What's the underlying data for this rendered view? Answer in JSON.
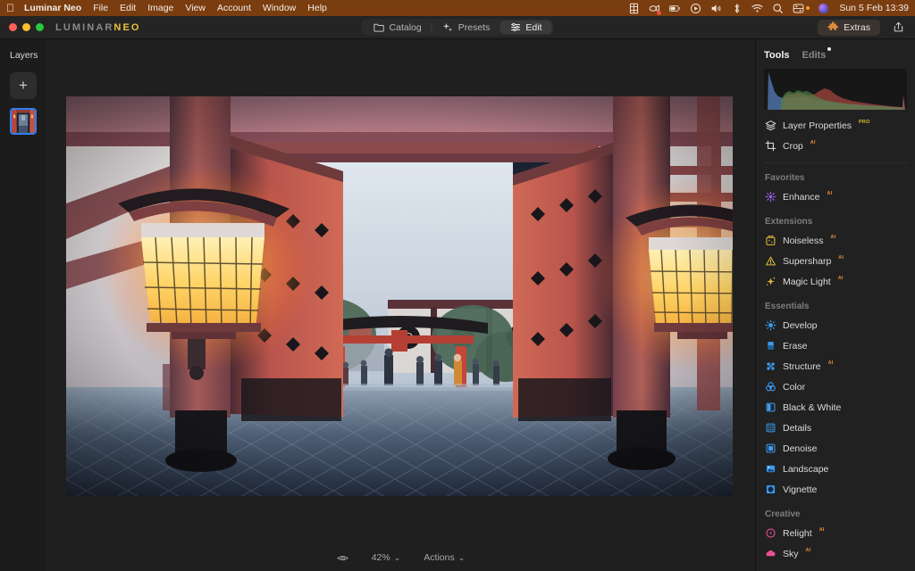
{
  "menubar": {
    "apple_icon": "apple-icon",
    "items": [
      {
        "label": "Luminar Neo",
        "bold": true
      },
      {
        "label": "File",
        "bold": false
      },
      {
        "label": "Edit",
        "bold": false
      },
      {
        "label": "Image",
        "bold": false
      },
      {
        "label": "View",
        "bold": false
      },
      {
        "label": "Account",
        "bold": false
      },
      {
        "label": "Window",
        "bold": false
      },
      {
        "label": "Help",
        "bold": false
      }
    ],
    "status_icons": [
      "display-icon",
      "screen-record-icon",
      "battery-icon",
      "play-circle-icon",
      "volume-icon",
      "bluetooth-icon",
      "wifi-icon",
      "search-icon",
      "control-center-icon",
      "user-avatar-icon"
    ],
    "clock": "Sun 5 Feb  13:39",
    "bg_color": "#7a3d10"
  },
  "toolbar": {
    "brand_primary": "LUMINAR",
    "brand_accent": "NEO",
    "brand_accent_color": "#e8c33c",
    "tabs": [
      {
        "label": "Catalog",
        "icon": "folder-icon",
        "active": false
      },
      {
        "label": "Presets",
        "icon": "sparkle-icon",
        "active": false
      },
      {
        "label": "Edit",
        "icon": "sliders-icon",
        "active": true
      }
    ],
    "extras_label": "Extras",
    "extras_icon": "puzzle-icon",
    "extras_icon_color": "#e08a3a",
    "share_icon": "share-icon"
  },
  "layers": {
    "title": "Layers",
    "add_label": "+",
    "thumbnail_name": "layer-thumbnail-torii-gate",
    "selection_color": "#2f7ef0"
  },
  "bottombar": {
    "compare_icon": "eye-icon",
    "zoom_value": "42%",
    "zoom_caret": "⌄",
    "actions_label": "Actions",
    "actions_caret": "⌄"
  },
  "tools": {
    "tab_tools": "Tools",
    "tab_edits": "Edits",
    "edits_has_badge": true,
    "histogram": {
      "channels": [
        "red",
        "green",
        "blue"
      ],
      "description": "RGB luminance histogram, blue-dominant with highlight spike at right edge"
    },
    "top_items": [
      {
        "label": "Layer Properties",
        "icon": "layers-stack-icon",
        "badge": "PRO",
        "badge_type": "pro",
        "color": "#e3e3e3"
      },
      {
        "label": "Crop",
        "icon": "crop-icon",
        "badge": "AI",
        "badge_type": "ai",
        "color": "#e3e3e3"
      }
    ],
    "groups": [
      {
        "label": "Favorites",
        "items": [
          {
            "label": "Enhance",
            "icon": "sparkle-burst-icon",
            "badge": "AI",
            "badge_type": "ai",
            "color": "#a060e8"
          }
        ]
      },
      {
        "label": "Extensions",
        "items": [
          {
            "label": "Noiseless",
            "icon": "noiseless-icon",
            "badge": "AI",
            "badge_type": "ai",
            "color": "#e0b93a"
          },
          {
            "label": "Supersharp",
            "icon": "supersharp-icon",
            "badge": "AI",
            "badge_type": "ai",
            "color": "#e0b93a"
          },
          {
            "label": "Magic Light",
            "icon": "magic-light-icon",
            "badge": "AI",
            "badge_type": "ai",
            "color": "#e0b93a"
          }
        ]
      },
      {
        "label": "Essentials",
        "items": [
          {
            "label": "Develop",
            "icon": "sun-icon",
            "badge": "",
            "badge_type": "",
            "color": "#3a9bf0"
          },
          {
            "label": "Erase",
            "icon": "eraser-icon",
            "badge": "",
            "badge_type": "",
            "color": "#3a9bf0"
          },
          {
            "label": "Structure",
            "icon": "structure-icon",
            "badge": "AI",
            "badge_type": "ai",
            "color": "#3a9bf0"
          },
          {
            "label": "Color",
            "icon": "color-wheel-icon",
            "badge": "",
            "badge_type": "",
            "color": "#3a9bf0"
          },
          {
            "label": "Black & White",
            "icon": "black-white-icon",
            "badge": "",
            "badge_type": "",
            "color": "#3a9bf0"
          },
          {
            "label": "Details",
            "icon": "details-grid-icon",
            "badge": "",
            "badge_type": "",
            "color": "#3a9bf0"
          },
          {
            "label": "Denoise",
            "icon": "denoise-icon",
            "badge": "",
            "badge_type": "",
            "color": "#3a9bf0"
          },
          {
            "label": "Landscape",
            "icon": "landscape-icon",
            "badge": "",
            "badge_type": "",
            "color": "#3a9bf0"
          },
          {
            "label": "Vignette",
            "icon": "vignette-icon",
            "badge": "",
            "badge_type": "",
            "color": "#3a9bf0"
          }
        ]
      },
      {
        "label": "Creative",
        "items": [
          {
            "label": "Relight",
            "icon": "relight-icon",
            "badge": "AI",
            "badge_type": "ai",
            "color": "#e8509b"
          },
          {
            "label": "Sky",
            "icon": "cloud-icon",
            "badge": "AI",
            "badge_type": "ai",
            "color": "#e8509b"
          }
        ]
      }
    ]
  },
  "photo": {
    "subject": "Japanese shrine gate interior at dusk with two glowing paper lanterns, vermilion pillars and doors, stone-paved courtyard and torii gate with visitors beyond",
    "zoom": "42%"
  }
}
